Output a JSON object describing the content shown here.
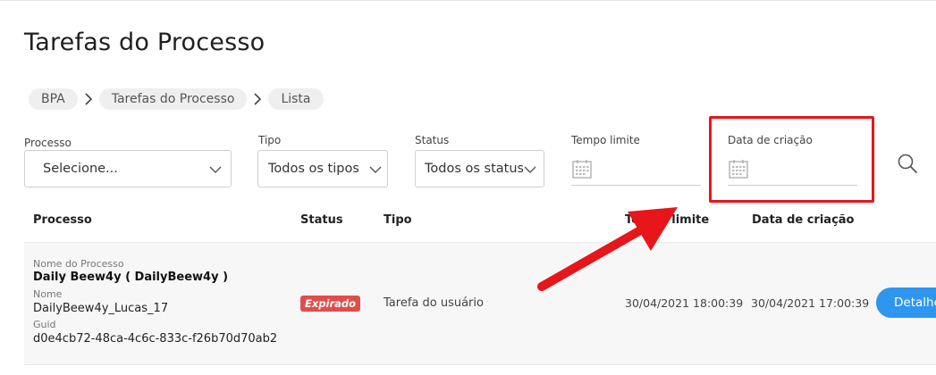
{
  "page": {
    "title": "Tarefas do Processo"
  },
  "breadcrumb": {
    "items": [
      "BPA",
      "Tarefas do Processo",
      "Lista"
    ]
  },
  "filters": {
    "processo": {
      "label": "Processo",
      "value": "Selecione..."
    },
    "tipo": {
      "label": "Tipo",
      "value": "Todos os tipos"
    },
    "status": {
      "label": "Status",
      "value": "Todos os status"
    },
    "tempo_limite": {
      "label": "Tempo limite"
    },
    "data_criacao": {
      "label": "Data de criação"
    }
  },
  "table": {
    "columns": [
      "Processo",
      "Status",
      "Tipo",
      "Tempo limite",
      "Data de criação"
    ],
    "rows": [
      {
        "nome_processo_label": "Nome do Processo",
        "nome_processo": "Daily Beew4y ( DailyBeew4y )",
        "nome_label": "Nome",
        "nome": "DailyBeew4y_Lucas_17",
        "guid_label": "Guid",
        "guid": "d0e4cb72-48ca-4c6c-833c-f26b70d70ab2",
        "status": "Expirado",
        "tipo": "Tarefa do usuário",
        "tempo_limite": "30/04/2021 18:00:39",
        "data_criacao": "30/04/2021 17:00:39",
        "action_label": "Detalhes"
      }
    ]
  },
  "colors": {
    "accent": "#2f96f0",
    "expired": "#e24c4b",
    "highlight": "#e8151b"
  },
  "icons": {
    "search": "search-icon",
    "calendar": "calendar-icon",
    "chevron": "chevron-down-icon"
  }
}
